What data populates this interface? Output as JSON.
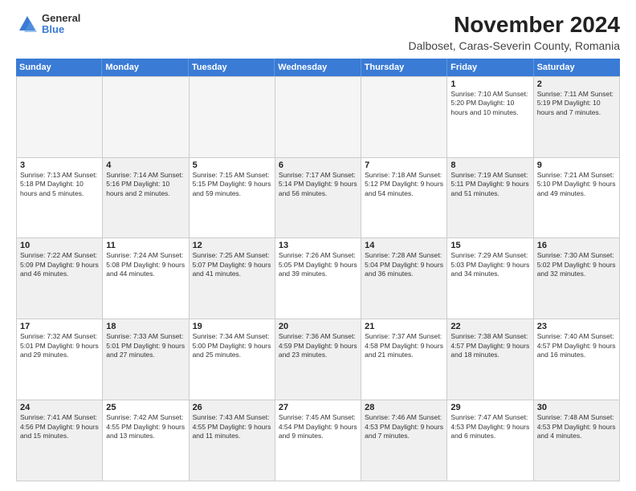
{
  "logo": {
    "general": "General",
    "blue": "Blue"
  },
  "header": {
    "month_title": "November 2024",
    "location": "Dalboset, Caras-Severin County, Romania"
  },
  "weekdays": [
    "Sunday",
    "Monday",
    "Tuesday",
    "Wednesday",
    "Thursday",
    "Friday",
    "Saturday"
  ],
  "weeks": [
    [
      {
        "day": "",
        "info": "",
        "empty": true
      },
      {
        "day": "",
        "info": "",
        "empty": true
      },
      {
        "day": "",
        "info": "",
        "empty": true
      },
      {
        "day": "",
        "info": "",
        "empty": true
      },
      {
        "day": "",
        "info": "",
        "empty": true
      },
      {
        "day": "1",
        "info": "Sunrise: 7:10 AM\nSunset: 5:20 PM\nDaylight: 10 hours\nand 10 minutes.",
        "empty": false
      },
      {
        "day": "2",
        "info": "Sunrise: 7:11 AM\nSunset: 5:19 PM\nDaylight: 10 hours\nand 7 minutes.",
        "empty": false,
        "shaded": true
      }
    ],
    [
      {
        "day": "3",
        "info": "Sunrise: 7:13 AM\nSunset: 5:18 PM\nDaylight: 10 hours\nand 5 minutes.",
        "empty": false
      },
      {
        "day": "4",
        "info": "Sunrise: 7:14 AM\nSunset: 5:16 PM\nDaylight: 10 hours\nand 2 minutes.",
        "empty": false,
        "shaded": true
      },
      {
        "day": "5",
        "info": "Sunrise: 7:15 AM\nSunset: 5:15 PM\nDaylight: 9 hours\nand 59 minutes.",
        "empty": false
      },
      {
        "day": "6",
        "info": "Sunrise: 7:17 AM\nSunset: 5:14 PM\nDaylight: 9 hours\nand 56 minutes.",
        "empty": false,
        "shaded": true
      },
      {
        "day": "7",
        "info": "Sunrise: 7:18 AM\nSunset: 5:12 PM\nDaylight: 9 hours\nand 54 minutes.",
        "empty": false
      },
      {
        "day": "8",
        "info": "Sunrise: 7:19 AM\nSunset: 5:11 PM\nDaylight: 9 hours\nand 51 minutes.",
        "empty": false,
        "shaded": true
      },
      {
        "day": "9",
        "info": "Sunrise: 7:21 AM\nSunset: 5:10 PM\nDaylight: 9 hours\nand 49 minutes.",
        "empty": false
      }
    ],
    [
      {
        "day": "10",
        "info": "Sunrise: 7:22 AM\nSunset: 5:09 PM\nDaylight: 9 hours\nand 46 minutes.",
        "empty": false,
        "shaded": true
      },
      {
        "day": "11",
        "info": "Sunrise: 7:24 AM\nSunset: 5:08 PM\nDaylight: 9 hours\nand 44 minutes.",
        "empty": false
      },
      {
        "day": "12",
        "info": "Sunrise: 7:25 AM\nSunset: 5:07 PM\nDaylight: 9 hours\nand 41 minutes.",
        "empty": false,
        "shaded": true
      },
      {
        "day": "13",
        "info": "Sunrise: 7:26 AM\nSunset: 5:05 PM\nDaylight: 9 hours\nand 39 minutes.",
        "empty": false
      },
      {
        "day": "14",
        "info": "Sunrise: 7:28 AM\nSunset: 5:04 PM\nDaylight: 9 hours\nand 36 minutes.",
        "empty": false,
        "shaded": true
      },
      {
        "day": "15",
        "info": "Sunrise: 7:29 AM\nSunset: 5:03 PM\nDaylight: 9 hours\nand 34 minutes.",
        "empty": false
      },
      {
        "day": "16",
        "info": "Sunrise: 7:30 AM\nSunset: 5:02 PM\nDaylight: 9 hours\nand 32 minutes.",
        "empty": false,
        "shaded": true
      }
    ],
    [
      {
        "day": "17",
        "info": "Sunrise: 7:32 AM\nSunset: 5:01 PM\nDaylight: 9 hours\nand 29 minutes.",
        "empty": false
      },
      {
        "day": "18",
        "info": "Sunrise: 7:33 AM\nSunset: 5:01 PM\nDaylight: 9 hours\nand 27 minutes.",
        "empty": false,
        "shaded": true
      },
      {
        "day": "19",
        "info": "Sunrise: 7:34 AM\nSunset: 5:00 PM\nDaylight: 9 hours\nand 25 minutes.",
        "empty": false
      },
      {
        "day": "20",
        "info": "Sunrise: 7:36 AM\nSunset: 4:59 PM\nDaylight: 9 hours\nand 23 minutes.",
        "empty": false,
        "shaded": true
      },
      {
        "day": "21",
        "info": "Sunrise: 7:37 AM\nSunset: 4:58 PM\nDaylight: 9 hours\nand 21 minutes.",
        "empty": false
      },
      {
        "day": "22",
        "info": "Sunrise: 7:38 AM\nSunset: 4:57 PM\nDaylight: 9 hours\nand 18 minutes.",
        "empty": false,
        "shaded": true
      },
      {
        "day": "23",
        "info": "Sunrise: 7:40 AM\nSunset: 4:57 PM\nDaylight: 9 hours\nand 16 minutes.",
        "empty": false
      }
    ],
    [
      {
        "day": "24",
        "info": "Sunrise: 7:41 AM\nSunset: 4:56 PM\nDaylight: 9 hours\nand 15 minutes.",
        "empty": false,
        "shaded": true
      },
      {
        "day": "25",
        "info": "Sunrise: 7:42 AM\nSunset: 4:55 PM\nDaylight: 9 hours\nand 13 minutes.",
        "empty": false
      },
      {
        "day": "26",
        "info": "Sunrise: 7:43 AM\nSunset: 4:55 PM\nDaylight: 9 hours\nand 11 minutes.",
        "empty": false,
        "shaded": true
      },
      {
        "day": "27",
        "info": "Sunrise: 7:45 AM\nSunset: 4:54 PM\nDaylight: 9 hours\nand 9 minutes.",
        "empty": false
      },
      {
        "day": "28",
        "info": "Sunrise: 7:46 AM\nSunset: 4:53 PM\nDaylight: 9 hours\nand 7 minutes.",
        "empty": false,
        "shaded": true
      },
      {
        "day": "29",
        "info": "Sunrise: 7:47 AM\nSunset: 4:53 PM\nDaylight: 9 hours\nand 6 minutes.",
        "empty": false
      },
      {
        "day": "30",
        "info": "Sunrise: 7:48 AM\nSunset: 4:53 PM\nDaylight: 9 hours\nand 4 minutes.",
        "empty": false,
        "shaded": true
      }
    ]
  ]
}
